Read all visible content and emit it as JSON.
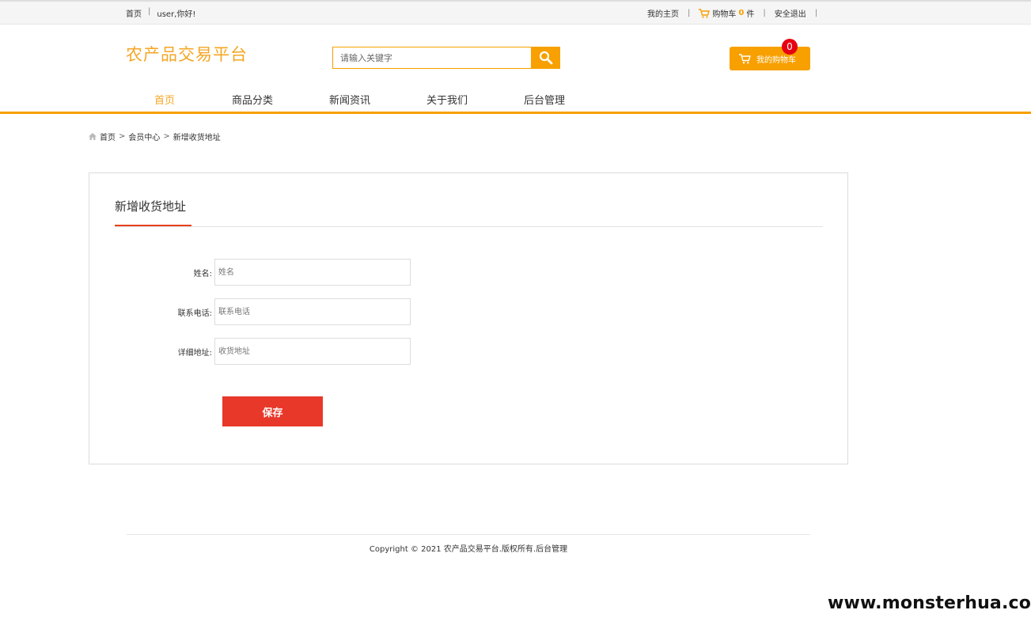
{
  "topbar": {
    "home": "首页",
    "separator": "|",
    "greeting": "user,你好!",
    "my_home": "我的主页",
    "cart_label": "购物车",
    "cart_count": "0",
    "cart_unit": "件",
    "logout": "安全退出"
  },
  "header": {
    "logo": "农产品交易平台",
    "search_placeholder": "请输入关键字",
    "cart_button": "我的购物车",
    "cart_badge": "0"
  },
  "nav": {
    "items": [
      {
        "label": "首页"
      },
      {
        "label": "商品分类"
      },
      {
        "label": "新闻资讯"
      },
      {
        "label": "关于我们"
      },
      {
        "label": "后台管理"
      }
    ]
  },
  "breadcrumb": {
    "items": [
      "首页",
      "会员中心",
      "新增收货地址"
    ],
    "arrow": ">"
  },
  "form": {
    "title": "新增收货地址",
    "fields": [
      {
        "label": "姓名:",
        "placeholder": "姓名"
      },
      {
        "label": "联系电话:",
        "placeholder": "联系电话"
      },
      {
        "label": "详细地址:",
        "placeholder": "收货地址"
      }
    ],
    "save_label": "保存"
  },
  "footer": {
    "copyright": "Copyright © 2021 农产品交易平台.版权所有.后台管理"
  },
  "watermark": "www.monsterhua.com",
  "colors": {
    "accent": "#f7a000",
    "save": "#e8382a",
    "badge": "#e60012"
  }
}
